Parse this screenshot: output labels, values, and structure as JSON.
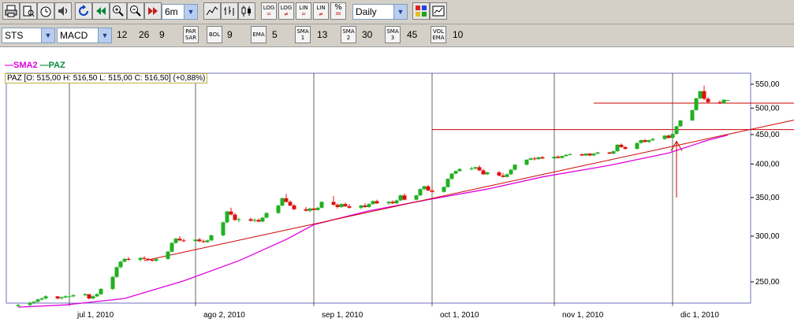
{
  "toolbar1": {
    "range_value": "6m",
    "interval_value": "Daily",
    "scale_buttons": [
      {
        "top": "LOG",
        "bottom": "="
      },
      {
        "top": "LOG",
        "bottom": "≠"
      },
      {
        "top": "LIN",
        "bottom": "="
      },
      {
        "top": "LIN",
        "bottom": "≠"
      },
      {
        "top": "%",
        "bottom": "="
      }
    ]
  },
  "toolbar2": {
    "symbol_value": "STS",
    "indicator_value": "MACD",
    "macd_fast": "12",
    "macd_slow": "26",
    "macd_signal": "9",
    "par_sar_label": "PAR SAR",
    "bol_label": "BOL",
    "bol_value": "9",
    "ema_label": "EMA",
    "ema_value": "5",
    "sma1_label": "SMA 1",
    "sma1_value": "13",
    "sma2_label": "SMA 2",
    "sma2_value": "30",
    "sma3_label": "SMA 3",
    "sma3_value": "45",
    "volema_label": "VOL EMA",
    "volema_value": "10"
  },
  "legend": {
    "sma2": "SMA2",
    "paz": "PAZ"
  },
  "ohlc_text": "PAZ [O: 515,00  H: 516,50  L: 515,00  C: 516,50] (+0,88%)",
  "colors": {
    "up": "#22b022",
    "down": "#e01010",
    "sma2": "#e000e0",
    "trend": "#cc0000",
    "axis": "#7070c0"
  },
  "chart_data": {
    "type": "candlestick",
    "symbol": "PAZ",
    "y_scale": "log",
    "ylim": [
      225,
      570
    ],
    "y_ticks": [
      250,
      300,
      350,
      400,
      450,
      500,
      550
    ],
    "y_tick_labels": [
      "250,00",
      "300,00",
      "350,00",
      "400,00",
      "450,00",
      "500,00",
      "550,00"
    ],
    "x_ticks": [
      {
        "date": "2010-07-01",
        "label": "jul 1, 2010"
      },
      {
        "date": "2010-08-02",
        "label": "ago 2, 2010"
      },
      {
        "date": "2010-09-01",
        "label": "sep 1, 2010"
      },
      {
        "date": "2010-10-01",
        "label": "oct 1, 2010"
      },
      {
        "date": "2010-11-01",
        "label": "nov 1, 2010"
      },
      {
        "date": "2010-12-01",
        "label": "dic 1, 2010"
      }
    ],
    "candles": [
      [
        "2010-06-18",
        227,
        229,
        226,
        228
      ],
      [
        "2010-06-21",
        228,
        231,
        227,
        230
      ],
      [
        "2010-06-22",
        230,
        231,
        229,
        231
      ],
      [
        "2010-06-23",
        231,
        234,
        230,
        233
      ],
      [
        "2010-06-24",
        233,
        235,
        232,
        234
      ],
      [
        "2010-06-25",
        234,
        237,
        233,
        236
      ],
      [
        "2010-06-28",
        236,
        235,
        233,
        234
      ],
      [
        "2010-06-29",
        234,
        236,
        233,
        235
      ],
      [
        "2010-06-30",
        235,
        237,
        234,
        236
      ],
      [
        "2010-07-01",
        236,
        237,
        235,
        236
      ],
      [
        "2010-07-02",
        236,
        238,
        235,
        237
      ],
      [
        "2010-07-05",
        237,
        239,
        236,
        238
      ],
      [
        "2010-07-06",
        238,
        236,
        233,
        234
      ],
      [
        "2010-07-07",
        234,
        237,
        233,
        236
      ],
      [
        "2010-07-08",
        236,
        239,
        235,
        238
      ],
      [
        "2010-07-09",
        238,
        244,
        237,
        243
      ],
      [
        "2010-07-12",
        243,
        256,
        242,
        255
      ],
      [
        "2010-07-13",
        255,
        266,
        254,
        265
      ],
      [
        "2010-07-14",
        265,
        272,
        264,
        271
      ],
      [
        "2010-07-15",
        271,
        275,
        270,
        274
      ],
      [
        "2010-07-16",
        274,
        276,
        272,
        273
      ],
      [
        "2010-07-19",
        273,
        276,
        271,
        275
      ],
      [
        "2010-07-20",
        275,
        277,
        273,
        274
      ],
      [
        "2010-07-21",
        274,
        275,
        272,
        273
      ],
      [
        "2010-07-22",
        273,
        274,
        271,
        272
      ],
      [
        "2010-07-23",
        272,
        275,
        271,
        274
      ],
      [
        "2010-07-26",
        274,
        283,
        273,
        282
      ],
      [
        "2010-07-27",
        282,
        293,
        281,
        292
      ],
      [
        "2010-07-28",
        292,
        298,
        291,
        297
      ],
      [
        "2010-07-29",
        297,
        300,
        294,
        295
      ],
      [
        "2010-07-30",
        295,
        297,
        293,
        294
      ],
      [
        "2010-08-02",
        294,
        298,
        293,
        296
      ],
      [
        "2010-08-03",
        296,
        298,
        293,
        294
      ],
      [
        "2010-08-04",
        294,
        296,
        292,
        293
      ],
      [
        "2010-08-05",
        293,
        296,
        292,
        295
      ],
      [
        "2010-08-06",
        295,
        302,
        294,
        301
      ],
      [
        "2010-08-09",
        301,
        318,
        300,
        317
      ],
      [
        "2010-08-10",
        317,
        332,
        316,
        331
      ],
      [
        "2010-08-11",
        331,
        336,
        326,
        327
      ],
      [
        "2010-08-12",
        327,
        329,
        319,
        320
      ],
      [
        "2010-08-13",
        320,
        323,
        317,
        321
      ],
      [
        "2010-08-16",
        321,
        323,
        318,
        319
      ],
      [
        "2010-08-17",
        319,
        322,
        317,
        320
      ],
      [
        "2010-08-18",
        320,
        322,
        317,
        318
      ],
      [
        "2010-08-19",
        318,
        324,
        317,
        323
      ],
      [
        "2010-08-20",
        323,
        330,
        322,
        329
      ],
      [
        "2010-08-23",
        329,
        340,
        328,
        339
      ],
      [
        "2010-08-24",
        339,
        350,
        338,
        349
      ],
      [
        "2010-08-25",
        349,
        355,
        343,
        344
      ],
      [
        "2010-08-26",
        344,
        346,
        338,
        339
      ],
      [
        "2010-08-27",
        339,
        341,
        333,
        334
      ],
      [
        "2010-08-30",
        334,
        337,
        331,
        332
      ],
      [
        "2010-08-31",
        332,
        336,
        330,
        335
      ],
      [
        "2010-09-01",
        335,
        337,
        332,
        333
      ],
      [
        "2010-09-02",
        333,
        337,
        332,
        336
      ],
      [
        "2010-09-03",
        336,
        345,
        335,
        344
      ],
      [
        "2010-09-06",
        344,
        352,
        339,
        340
      ],
      [
        "2010-09-07",
        340,
        342,
        335,
        337
      ],
      [
        "2010-09-08",
        337,
        342,
        336,
        341
      ],
      [
        "2010-09-09",
        341,
        343,
        337,
        338
      ],
      [
        "2010-09-10",
        338,
        341,
        335,
        336
      ],
      [
        "2010-09-13",
        336,
        340,
        334,
        339
      ],
      [
        "2010-09-14",
        339,
        342,
        336,
        337
      ],
      [
        "2010-09-15",
        337,
        342,
        336,
        341
      ],
      [
        "2010-09-16",
        341,
        346,
        340,
        345
      ],
      [
        "2010-09-17",
        345,
        347,
        341,
        342
      ],
      [
        "2010-09-20",
        342,
        345,
        340,
        344
      ],
      [
        "2010-09-21",
        344,
        346,
        341,
        342
      ],
      [
        "2010-09-22",
        342,
        347,
        341,
        346
      ],
      [
        "2010-09-23",
        346,
        354,
        345,
        353
      ],
      [
        "2010-09-24",
        353,
        356,
        346,
        347
      ],
      [
        "2010-09-27",
        347,
        354,
        346,
        353
      ],
      [
        "2010-09-28",
        353,
        363,
        352,
        362
      ],
      [
        "2010-09-29",
        362,
        367,
        360,
        366
      ],
      [
        "2010-09-30",
        366,
        368,
        359,
        360
      ],
      [
        "2010-10-01",
        360,
        364,
        357,
        358
      ],
      [
        "2010-10-04",
        358,
        366,
        357,
        365
      ],
      [
        "2010-10-05",
        365,
        378,
        364,
        377
      ],
      [
        "2010-10-06",
        377,
        386,
        376,
        385
      ],
      [
        "2010-10-07",
        385,
        390,
        384,
        389
      ],
      [
        "2010-10-08",
        389,
        394,
        388,
        392
      ],
      [
        "2010-10-11",
        392,
        396,
        390,
        393
      ],
      [
        "2010-10-12",
        393,
        396,
        391,
        395
      ],
      [
        "2010-10-13",
        395,
        398,
        389,
        390
      ],
      [
        "2010-10-14",
        390,
        392,
        383,
        384
      ],
      [
        "2010-10-15",
        384,
        388,
        383,
        387
      ],
      [
        "2010-10-18",
        387,
        389,
        381,
        382
      ],
      [
        "2010-10-19",
        382,
        386,
        379,
        380
      ],
      [
        "2010-10-20",
        380,
        385,
        379,
        384
      ],
      [
        "2010-10-21",
        384,
        392,
        383,
        391
      ],
      [
        "2010-10-22",
        391,
        400,
        390,
        399
      ],
      [
        "2010-10-25",
        399,
        408,
        398,
        407
      ],
      [
        "2010-10-26",
        407,
        411,
        406,
        409
      ],
      [
        "2010-10-27",
        409,
        412,
        406,
        408
      ],
      [
        "2010-10-28",
        408,
        412,
        407,
        411
      ],
      [
        "2010-10-29",
        411,
        413,
        408,
        409
      ],
      [
        "2010-11-01",
        409,
        413,
        408,
        412
      ],
      [
        "2010-11-02",
        412,
        414,
        409,
        410
      ],
      [
        "2010-11-03",
        410,
        414,
        409,
        413
      ],
      [
        "2010-11-04",
        413,
        416,
        412,
        415
      ],
      [
        "2010-11-05",
        415,
        418,
        414,
        416
      ],
      [
        "2010-11-08",
        416,
        417,
        413,
        414
      ],
      [
        "2010-11-09",
        414,
        418,
        413,
        417
      ],
      [
        "2010-11-10",
        417,
        418,
        413,
        414
      ],
      [
        "2010-11-11",
        414,
        418,
        413,
        417
      ],
      [
        "2010-11-12",
        417,
        420,
        416,
        419
      ],
      [
        "2010-11-15",
        419,
        420,
        416,
        417
      ],
      [
        "2010-11-16",
        417,
        422,
        416,
        421
      ],
      [
        "2010-11-17",
        421,
        433,
        420,
        432
      ],
      [
        "2010-11-18",
        432,
        434,
        427,
        428
      ],
      [
        "2010-11-19",
        428,
        430,
        424,
        425
      ],
      [
        "2010-11-22",
        425,
        436,
        424,
        435
      ],
      [
        "2010-11-23",
        435,
        441,
        434,
        440
      ],
      [
        "2010-11-24",
        440,
        442,
        436,
        437
      ],
      [
        "2010-11-25",
        437,
        441,
        435,
        440
      ],
      [
        "2010-11-26",
        440,
        444,
        438,
        442
      ],
      [
        "2010-11-29",
        442,
        449,
        441,
        448
      ],
      [
        "2010-11-30",
        448,
        450,
        443,
        444
      ],
      [
        "2010-12-01",
        444,
        452,
        443,
        451
      ],
      [
        "2010-12-02",
        451,
        466,
        450,
        465
      ],
      [
        "2010-12-03",
        465,
        477,
        464,
        476
      ],
      [
        "2010-12-06",
        476,
        497,
        475,
        496
      ],
      [
        "2010-12-07",
        496,
        521,
        495,
        520
      ],
      [
        "2010-12-08",
        520,
        536,
        518,
        535
      ],
      [
        "2010-12-09",
        535,
        547,
        516,
        519
      ],
      [
        "2010-12-10",
        519,
        522,
        510,
        512
      ],
      [
        "2010-12-13",
        512,
        516,
        508,
        510
      ],
      [
        "2010-12-14",
        510,
        518,
        509,
        517
      ],
      [
        "2010-12-15",
        515,
        516.5,
        515,
        516.5
      ]
    ],
    "sma2_points": [
      [
        "2010-06-18",
        226
      ],
      [
        "2010-06-30",
        228
      ],
      [
        "2010-07-15",
        234
      ],
      [
        "2010-07-30",
        251
      ],
      [
        "2010-08-13",
        272
      ],
      [
        "2010-08-25",
        296
      ],
      [
        "2010-09-01",
        314
      ],
      [
        "2010-09-15",
        332
      ],
      [
        "2010-09-30",
        347
      ],
      [
        "2010-10-15",
        362
      ],
      [
        "2010-10-29",
        380
      ],
      [
        "2010-11-15",
        398
      ],
      [
        "2010-11-30",
        418
      ],
      [
        "2010-12-10",
        440
      ],
      [
        "2010-12-15",
        449
      ]
    ],
    "trendlines": [
      {
        "from": [
          "2010-07-20",
          272
        ],
        "to": [
          "2011-01-10",
          492
        ]
      },
      {
        "from": [
          "2010-10-01",
          459
        ],
        "to": [
          "2011-01-10",
          459
        ]
      },
      {
        "from": [
          "2010-11-11",
          510
        ],
        "to": [
          "2011-01-10",
          510
        ]
      }
    ],
    "annotation_arrow": {
      "date": "2010-12-02",
      "from": 350,
      "to": 438
    }
  }
}
